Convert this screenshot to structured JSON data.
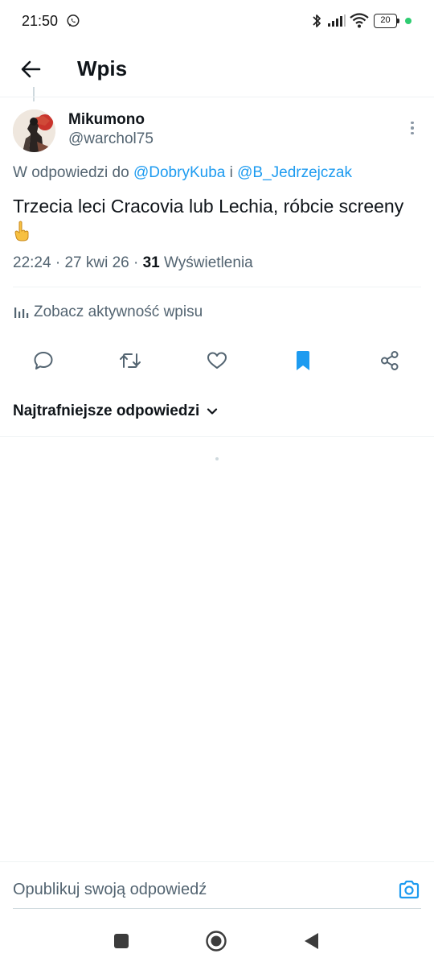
{
  "status_bar": {
    "time": "21:50",
    "battery_level": "20",
    "icons": [
      "whatsapp-icon",
      "bluetooth-icon",
      "signal-icon",
      "wifi-icon",
      "battery-icon",
      "status-dot"
    ]
  },
  "header": {
    "title": "Wpis",
    "back_icon": "arrow-left-icon"
  },
  "tweet": {
    "author_name": "Mikumono",
    "author_handle": "@warchol75",
    "reply_prefix": "W odpowiedzi do",
    "reply_mention_1": "@DobryKuba",
    "reply_conjunction": "i",
    "reply_mention_2": "@B_Jedrzejczak",
    "text": "Trzecia leci Cracovia lub Lechia, róbcie screeny",
    "emoji": "pointing-up-hand-emoji",
    "time": "22:24",
    "date": "27 kwi 26",
    "separator": "·",
    "views_count": "31",
    "views_label": "Wyświetlenia",
    "activity_label": "Zobacz aktywność wpisu",
    "actions": [
      "reply-icon",
      "retweet-icon",
      "like-icon",
      "bookmark-icon",
      "share-icon"
    ],
    "bookmarked": true
  },
  "replies": {
    "sort_label": "Najtrafniejsze odpowiedzi"
  },
  "composer": {
    "placeholder": "Opublikuj swoją odpowiedź"
  },
  "colors": {
    "accent": "#1d9bf0",
    "text_primary": "#0f1419",
    "text_secondary": "#536471",
    "divider": "#eff3f4"
  }
}
